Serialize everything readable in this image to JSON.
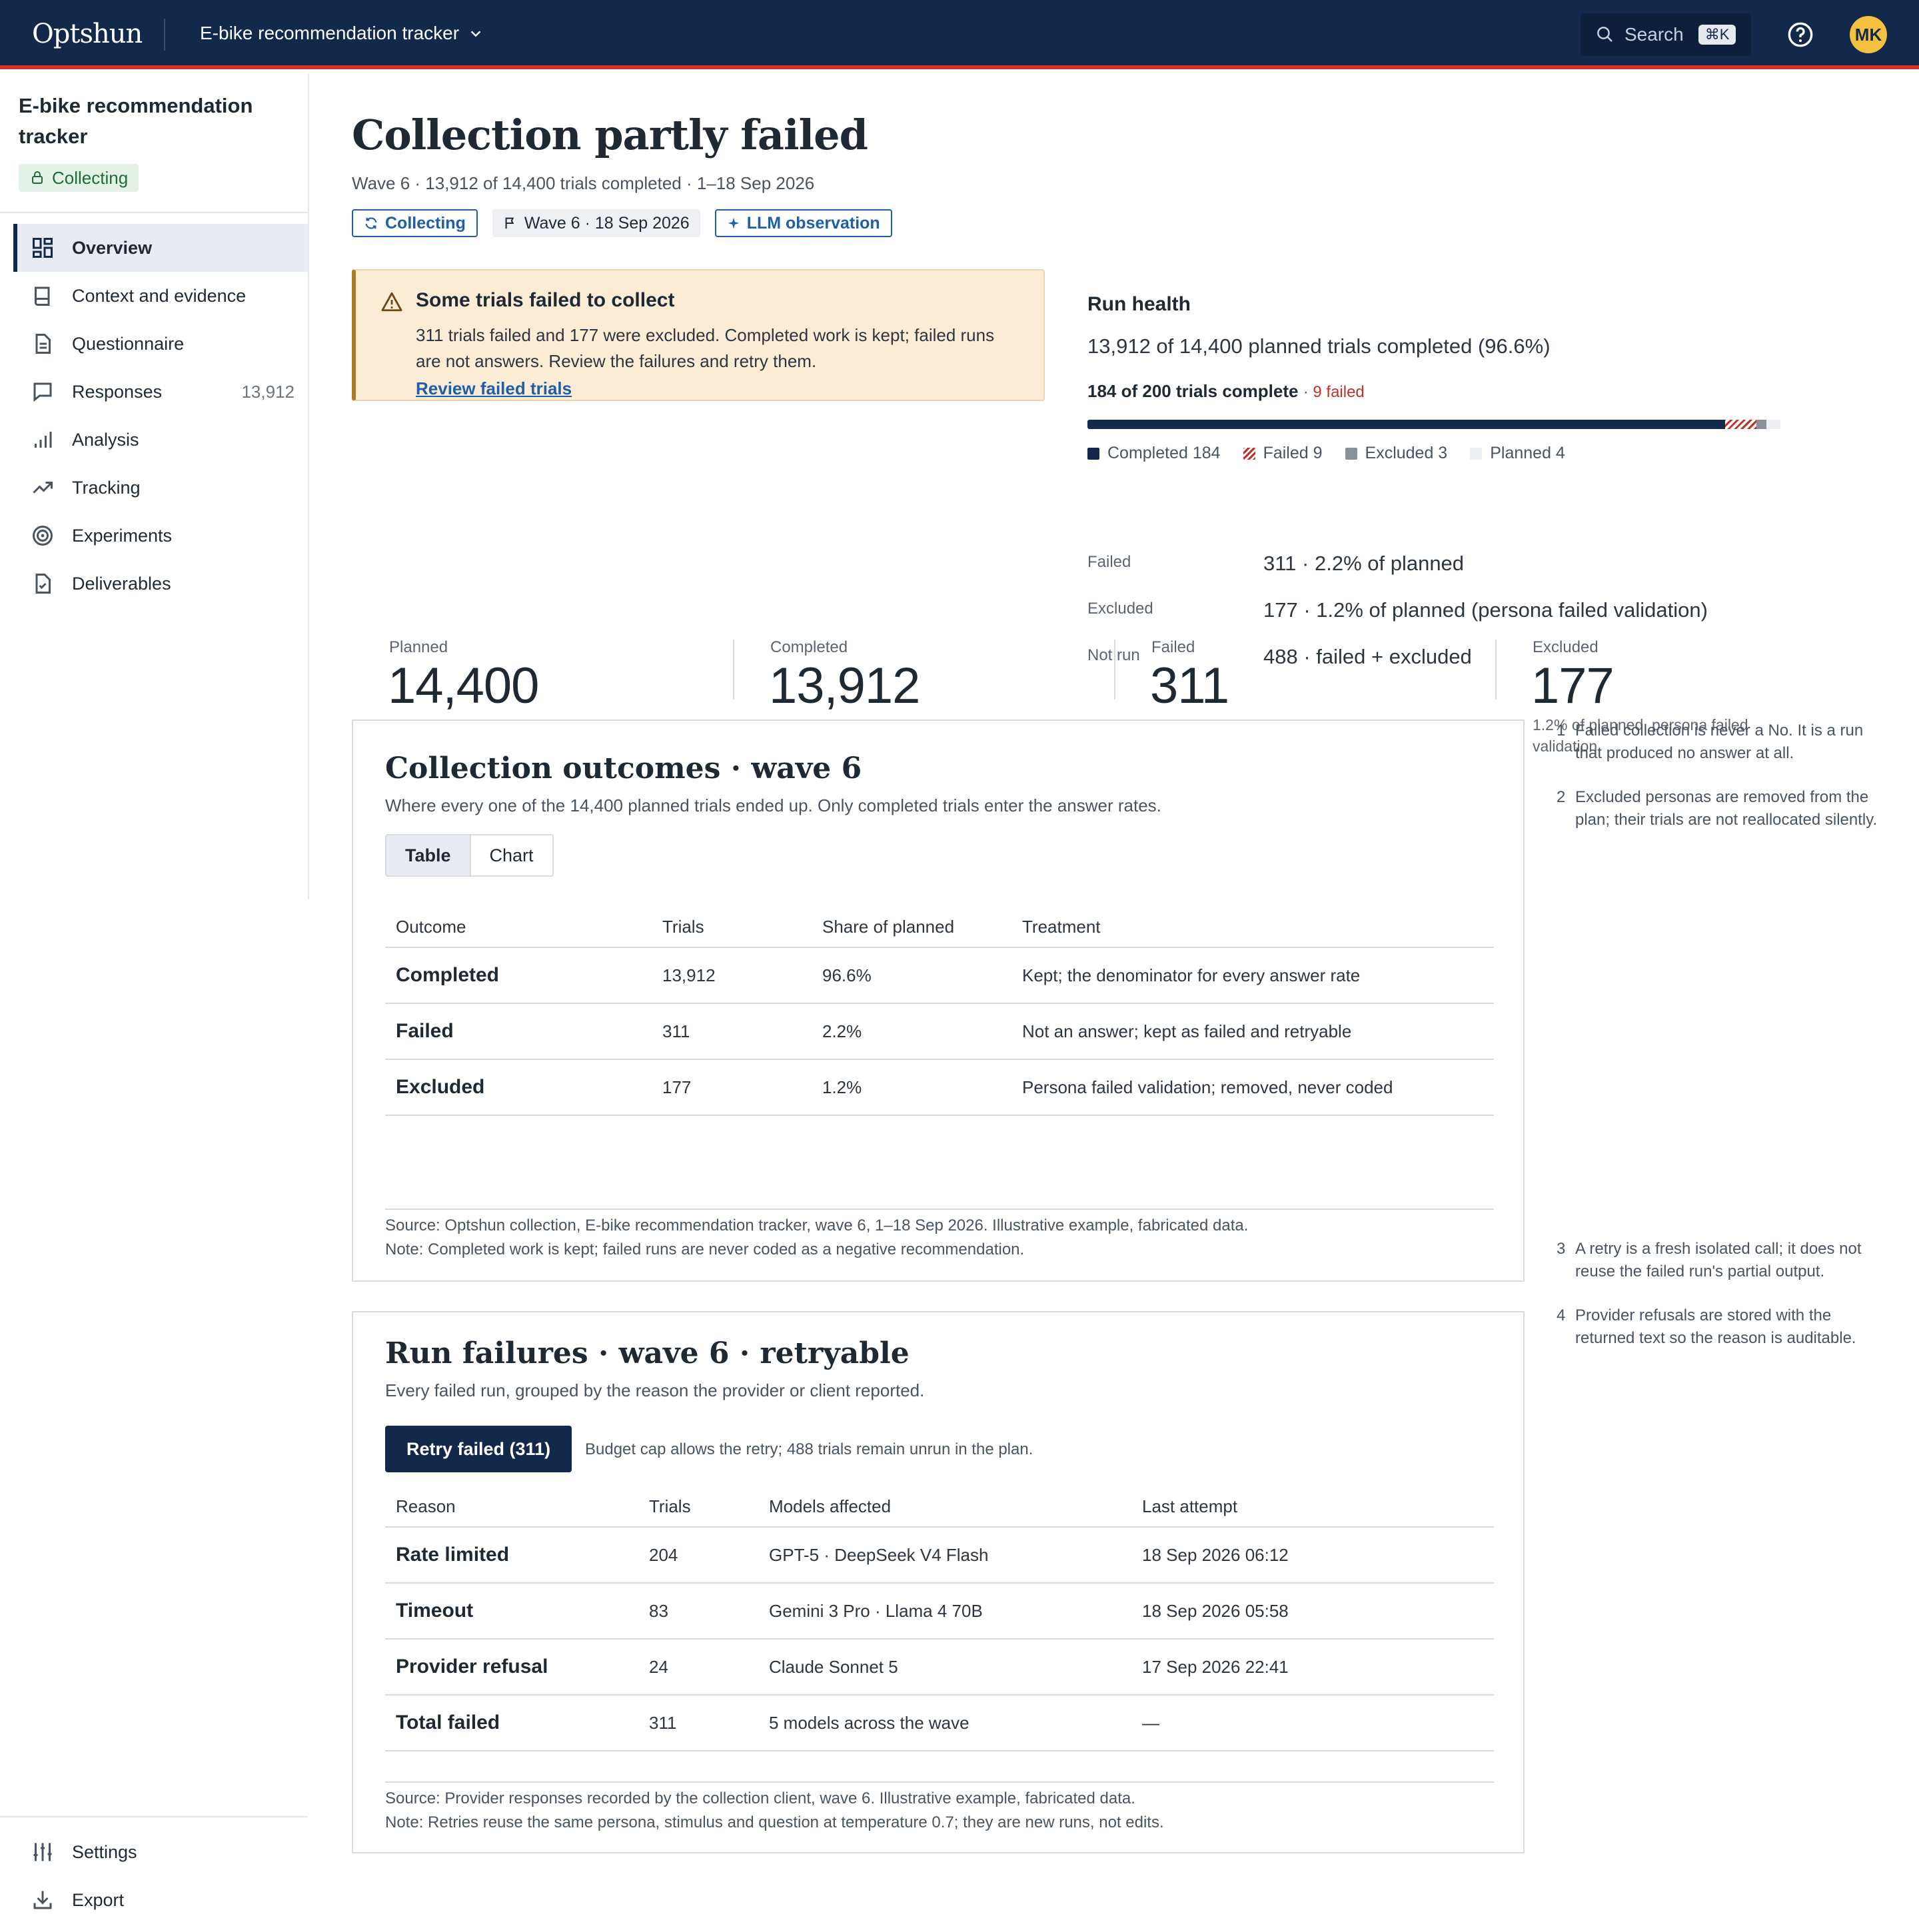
{
  "topbar": {
    "logo": "Optshun",
    "project": "E-bike recommendation tracker",
    "search_label": "Search",
    "search_kbd": "⌘K",
    "avatar": "MK",
    "colors": {
      "background": "#13294b",
      "accent_rule": "#d6322d",
      "avatar": "#f4c13f"
    }
  },
  "sidebar": {
    "title": "E-bike recommendation tracker",
    "status": "Collecting",
    "items": [
      {
        "label": "Overview",
        "icon": "grid-icon",
        "active": true
      },
      {
        "label": "Context and evidence",
        "icon": "book-icon"
      },
      {
        "label": "Questionnaire",
        "icon": "document-icon"
      },
      {
        "label": "Responses",
        "icon": "speech-bubble-icon",
        "count": "13,912"
      },
      {
        "label": "Analysis",
        "icon": "bar-chart-icon"
      },
      {
        "label": "Tracking",
        "icon": "trend-icon"
      },
      {
        "label": "Experiments",
        "icon": "target-icon"
      },
      {
        "label": "Deliverables",
        "icon": "file-check-icon"
      }
    ],
    "footer": [
      {
        "label": "Settings",
        "icon": "sliders-icon"
      },
      {
        "label": "Export",
        "icon": "download-icon"
      }
    ]
  },
  "header": {
    "title": "Collection partly failed",
    "subline": "Wave 6 · 13,912 of 14,400 trials completed · 1–18 Sep 2026",
    "chips": {
      "collecting": "Collecting",
      "wave": "Wave 6 · 18 Sep 2026",
      "llm": "LLM observation"
    }
  },
  "alert": {
    "title": "Some trials failed to collect",
    "body": "311 trials failed and 177 were excluded. Completed work is kept; failed runs are not answers. Review the failures and retry them.",
    "link": "Review failed trials"
  },
  "run_health": {
    "title": "Run health",
    "summary": "13,912 of 14,400 planned trials completed (96.6%)",
    "progress_label": "184 of 200 trials complete",
    "progress_failed": "· 9 failed",
    "progress": {
      "completed": 184,
      "failed": 9,
      "excluded": 3,
      "planned": 4,
      "total": 200
    },
    "legend": {
      "completed": "Completed 184",
      "failed": "Failed 9",
      "excluded": "Excluded 3",
      "planned": "Planned 4"
    },
    "rows": [
      {
        "label": "Failed",
        "value": "311 · 2.2% of planned"
      },
      {
        "label": "Excluded",
        "value": "177 · 1.2% of planned (persona failed validation)"
      },
      {
        "label": "Not run",
        "value": "488 · failed + excluded"
      }
    ]
  },
  "stats": [
    {
      "label": "Planned",
      "value": "14,400"
    },
    {
      "label": "Completed",
      "value": "13,912"
    },
    {
      "label": "Failed",
      "value": "311"
    },
    {
      "label": "Excluded",
      "value": "177",
      "caption": "1.2% of planned, persona failed validation"
    }
  ],
  "outcomes": {
    "title": "Collection outcomes · wave 6",
    "subtitle": "Where every one of the 14,400 planned trials ended up. Only completed trials enter the answer rates.",
    "toggle": {
      "table": "Table",
      "chart": "Chart"
    },
    "columns": [
      "Outcome",
      "Trials",
      "Share of planned",
      "Treatment"
    ],
    "rows": [
      [
        "Completed",
        "13,912",
        "96.6%",
        "Kept; the denominator for every answer rate"
      ],
      [
        "Failed",
        "311",
        "2.2%",
        "Not an answer; kept as failed and retryable"
      ],
      [
        "Excluded",
        "177",
        "1.2%",
        "Persona failed validation; removed, never coded"
      ]
    ],
    "source": "Source: Optshun collection, E-bike recommendation tracker, wave 6, 1–18 Sep 2026. Illustrative example, fabricated data.",
    "note": "Note: Completed work is kept; failed runs are never coded as a negative recommendation."
  },
  "failures": {
    "title": "Run failures · wave 6 · retryable",
    "subtitle": "Every failed run, grouped by the reason the provider or client reported.",
    "retry_button": "Retry failed (311)",
    "retry_note": "Budget cap allows the retry; 488 trials remain unrun in the plan.",
    "columns": [
      "Reason",
      "Trials",
      "Models affected",
      "Last attempt"
    ],
    "rows": [
      [
        "Rate limited",
        "204",
        "GPT-5 · DeepSeek V4 Flash",
        "18 Sep 2026 06:12"
      ],
      [
        "Timeout",
        "83",
        "Gemini 3 Pro · Llama 4 70B",
        "18 Sep 2026 05:58"
      ],
      [
        "Provider refusal",
        "24",
        "Claude Sonnet 5",
        "17 Sep 2026 22:41"
      ],
      [
        "Total failed",
        "311",
        "5 models across the wave",
        "—"
      ]
    ],
    "source": "Source: Provider responses recorded by the collection client, wave 6. Illustrative example, fabricated data.",
    "note": "Note: Retries reuse the same persona, stimulus and question at temperature 0.7; they are new runs, not edits."
  },
  "side_notes": [
    {
      "n": "1",
      "text": "Failed collection is never a No. It is a run that produced no answer at all."
    },
    {
      "n": "2",
      "text": "Excluded personas are removed from the plan; their trials are not reallocated silently."
    },
    {
      "n": "3",
      "text": "A retry is a fresh isolated call; it does not reuse the failed run's partial output."
    },
    {
      "n": "4",
      "text": "Provider refusals are stored with the returned text so the reason is auditable."
    }
  ]
}
